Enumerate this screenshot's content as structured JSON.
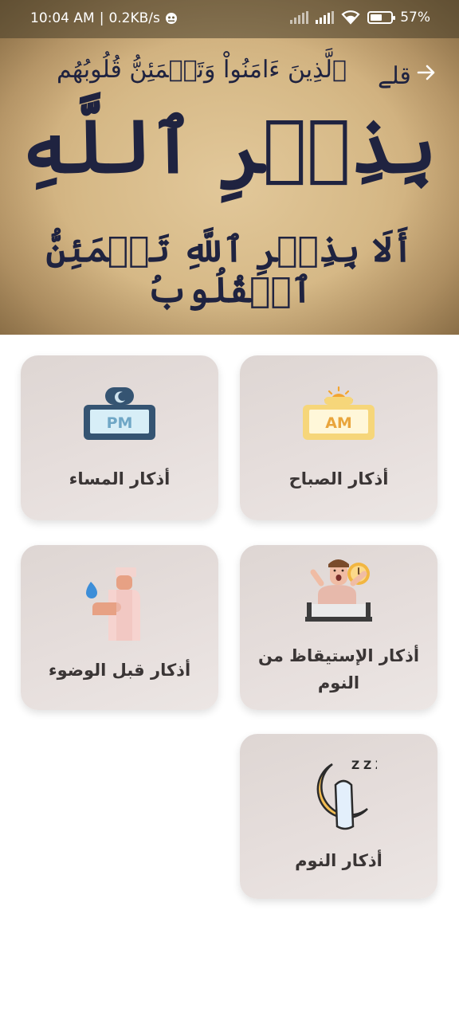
{
  "status_bar": {
    "time": "10:04 AM",
    "separator": "|",
    "net_speed": "0.2KB/s",
    "battery_pct": "57%",
    "battery_level": 0.57
  },
  "banner": {
    "line_1": "ٱلَّذِينَ ءَامَنُواْ وَتَطۡمَئِنُّ قُلُوبُهُم",
    "mark": "قلے",
    "line_2": "بِذِكۡرِ ٱللَّهِ",
    "line_3": "أَلَا بِذِكۡرِ ٱللَّهِ تَطۡمَئِنُّ ٱلۡقُلُوبُ"
  },
  "cards": [
    {
      "id": "morning",
      "label": "أذكار الصباح",
      "icon": "am-sign-icon",
      "icon_text": "AM"
    },
    {
      "id": "evening",
      "label": "أذكار المساء",
      "icon": "pm-sign-icon",
      "icon_text": "PM"
    },
    {
      "id": "waking",
      "label": "أذكار الإستيقاظ من النوم",
      "icon": "waking-man-icon"
    },
    {
      "id": "wudu",
      "label": "أذكار قبل الوضوء",
      "icon": "wudu-icon"
    },
    {
      "id": "sleep",
      "label": "أذكار النوم",
      "icon": "sleep-moon-icon",
      "icon_text": "Z Z Z"
    }
  ],
  "colors": {
    "card_bg": "#e3dbd8",
    "label": "#3a3535",
    "calligraphy": "#1f2340",
    "am_yellow": "#f6d67a",
    "pm_navy": "#355472"
  }
}
